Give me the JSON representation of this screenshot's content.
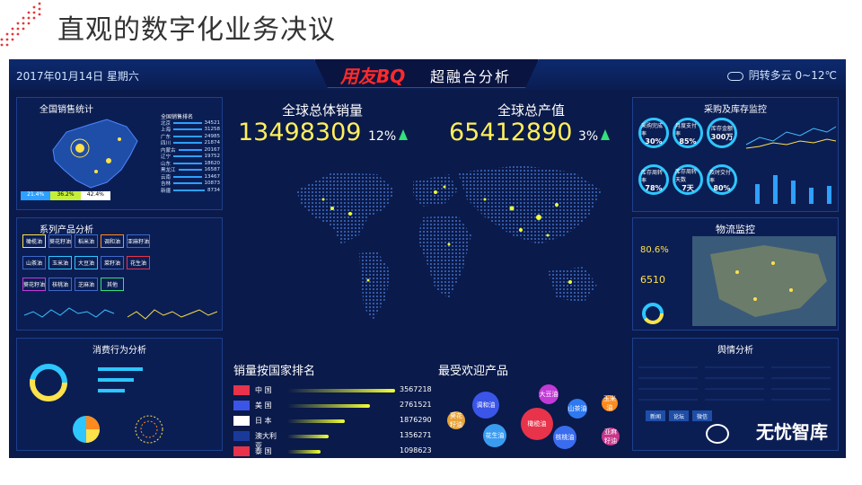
{
  "slide": {
    "title": "直观的数字化业务决议"
  },
  "header": {
    "date": "2017年01月14日 星期六",
    "brand": "用友BQ",
    "brand_sub": "超融合分析",
    "weather": "阴转多云 0~12℃"
  },
  "metrics": {
    "sales_title": "全球总体销量",
    "sales_value": "13498309",
    "sales_pct": "12%",
    "output_title": "全球总产值",
    "output_value": "65412890",
    "output_pct": "3%"
  },
  "panels": {
    "sales_stats": "全国销售统计",
    "sales_ranking_title": "全国销售排名",
    "series": "系列产品分析",
    "consumer": "消费行为分析",
    "purchase": "采购及库存监控",
    "logistics": "物流监控",
    "public_opinion": "舆情分析"
  },
  "ranking_list": [
    {
      "name": "北京",
      "value": "34521"
    },
    {
      "name": "上海",
      "value": "31258"
    },
    {
      "name": "广东",
      "value": "24985"
    },
    {
      "name": "四川",
      "value": "21874"
    },
    {
      "name": "内蒙古",
      "value": "20167"
    },
    {
      "name": "辽宁",
      "value": "19752"
    },
    {
      "name": "山东",
      "value": "18620"
    },
    {
      "name": "黑龙江",
      "value": "16587"
    },
    {
      "name": "云南",
      "value": "13467"
    },
    {
      "name": "吉林",
      "value": "10873"
    },
    {
      "name": "新疆",
      "value": "8734"
    }
  ],
  "legend_pcts": [
    "21.4%",
    "36.2%",
    "42.4%"
  ],
  "series_products": [
    "橄榄油",
    "葵花籽油",
    "稻米油",
    "调和油",
    "亚麻籽油",
    "山茶油",
    "玉米油",
    "大豆油",
    "菜籽油",
    "花生油",
    "葵花籽油",
    "核桃油",
    "芝麻油",
    "其他"
  ],
  "purchase_rings": [
    {
      "label": "采购完成率",
      "value": "30%"
    },
    {
      "label": "月度支付率",
      "value": "85%"
    },
    {
      "label": "库存金额",
      "value": "300万"
    },
    {
      "label": "库存周转率",
      "value": "78%"
    },
    {
      "label": "库存周转天数",
      "value": "7天"
    },
    {
      "label": "及时交付率",
      "value": "80%"
    }
  ],
  "logistics_values": {
    "pct": "80.6%",
    "num": "6510"
  },
  "country_section": "销量按国家排名",
  "countries": [
    {
      "name": "中 国",
      "value": "3567218",
      "bar": 1.0
    },
    {
      "name": "美 国",
      "value": "2761521",
      "bar": 0.77
    },
    {
      "name": "日 本",
      "value": "1876290",
      "bar": 0.53
    },
    {
      "name": "澳大利亚",
      "value": "1356271",
      "bar": 0.38
    },
    {
      "name": "泰 国",
      "value": "1098623",
      "bar": 0.31
    }
  ],
  "popular_section": "最受欢迎产品",
  "popular_products": [
    {
      "name": "调和油",
      "color": "#3a55e8"
    },
    {
      "name": "大豆油",
      "color": "#c33ad8"
    },
    {
      "name": "山茶油",
      "color": "#2f79f0"
    },
    {
      "name": "玉米油",
      "color": "#ff8b1f"
    },
    {
      "name": "橄榄油",
      "color": "#e8334a"
    },
    {
      "name": "葵花籽油",
      "color": "#e8a238"
    },
    {
      "name": "花生油",
      "color": "#3a9cf0"
    },
    {
      "name": "核桃油",
      "color": "#3a6cf0"
    },
    {
      "name": "亚麻籽油",
      "color": "#c7368a"
    }
  ],
  "opinion_tabs": [
    "新闻",
    "论坛",
    "微信"
  ],
  "watermark": "无忧智库"
}
